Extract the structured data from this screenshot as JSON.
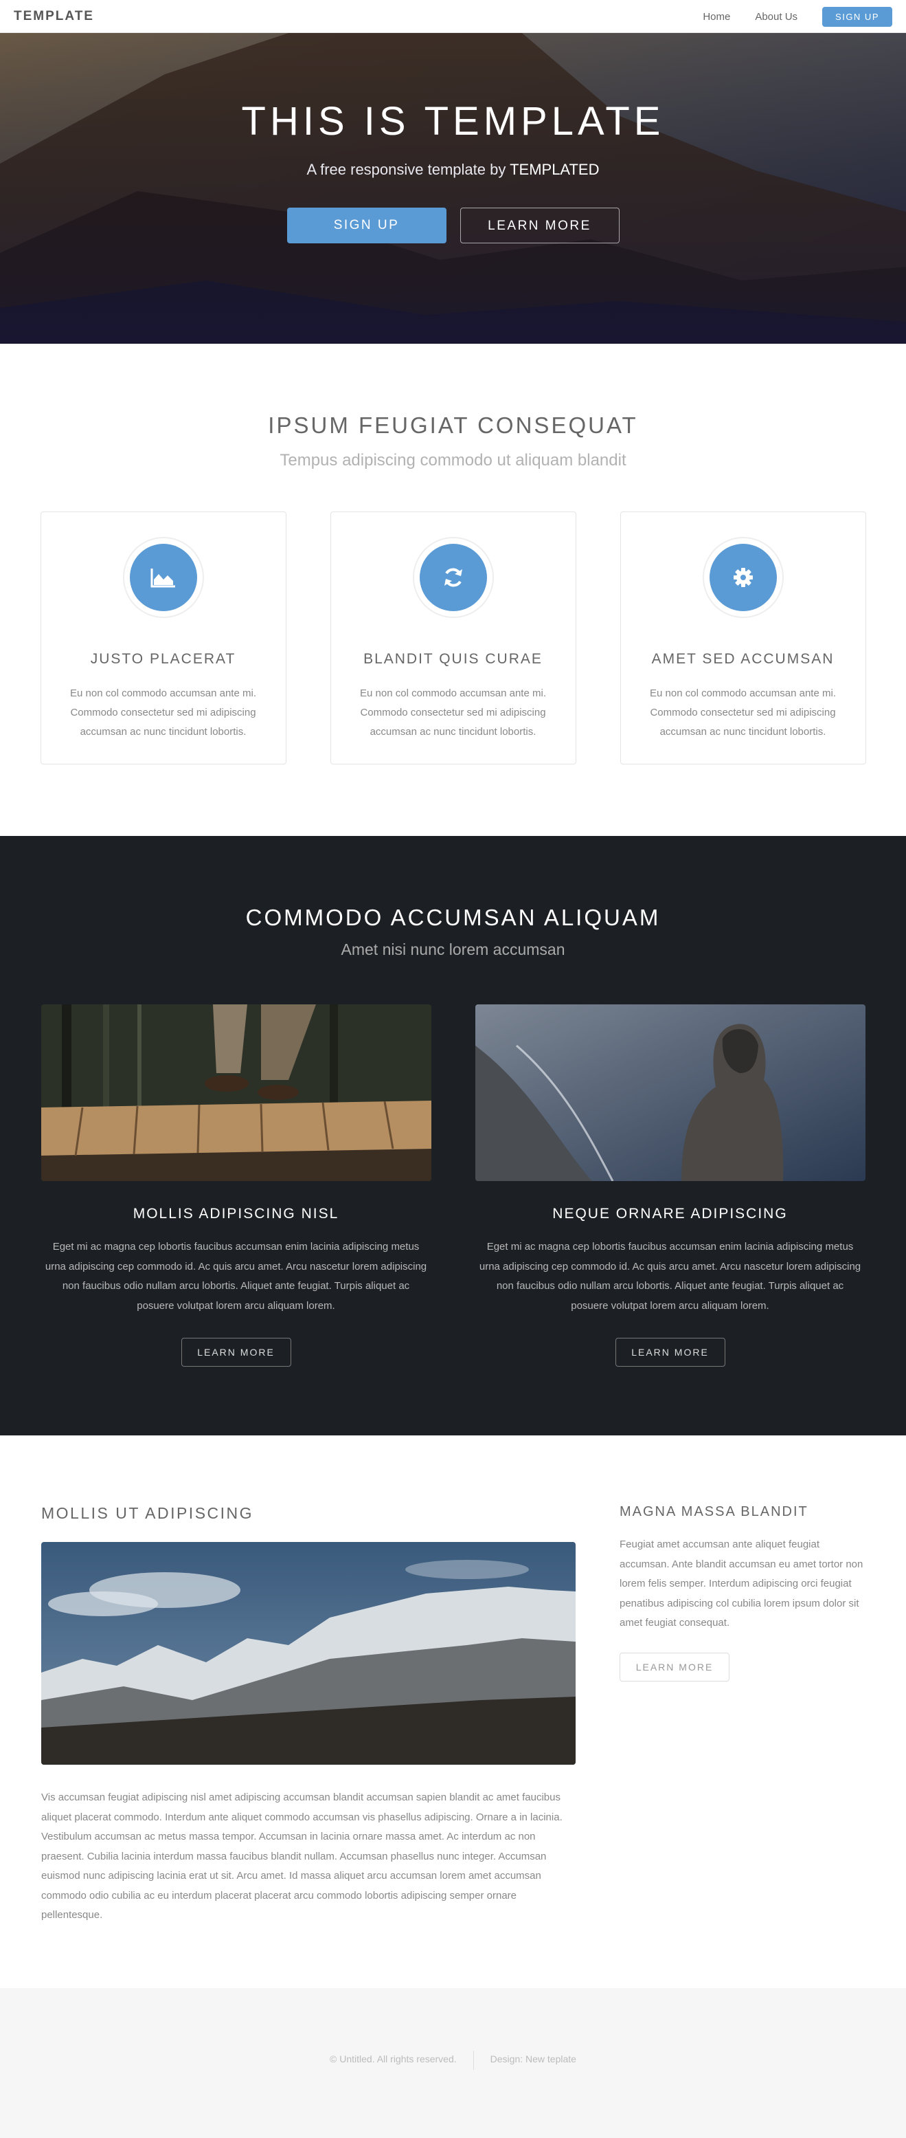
{
  "header": {
    "logo": "TEMPLATE",
    "nav": [
      "Home",
      "About Us"
    ],
    "signup": "SIGN UP"
  },
  "banner": {
    "title": "THIS IS TEMPLATE",
    "subtitle_prefix": "A free responsive template by",
    "subtitle_brand": "TEMPLATED",
    "primary_button": "SIGN UP",
    "secondary_button": "LEARN MORE"
  },
  "features": {
    "title": "IPSUM FEUGIAT CONSEQUAT",
    "subtitle": "Tempus adipiscing commodo ut aliquam blandit",
    "cards": [
      {
        "icon": "area-chart-icon",
        "title": "JUSTO PLACERAT",
        "text": "Eu non col commodo accumsan ante mi. Commodo consectetur sed mi adipiscing accumsan ac nunc tincidunt lobortis."
      },
      {
        "icon": "refresh-icon",
        "title": "BLANDIT QUIS CURAE",
        "text": "Eu non col commodo accumsan ante mi. Commodo consectetur sed mi adipiscing accumsan ac nunc tincidunt lobortis."
      },
      {
        "icon": "gear-icon",
        "title": "AMET SED ACCUMSAN",
        "text": "Eu non col commodo accumsan ante mi. Commodo consectetur sed mi adipiscing accumsan ac nunc tincidunt lobortis."
      }
    ]
  },
  "dark": {
    "title": "COMMODO ACCUMSAN ALIQUAM",
    "subtitle": "Amet nisi nunc lorem accumsan",
    "columns": [
      {
        "title": "MOLLIS ADIPISCING NISL",
        "text": "Eget mi ac magna cep lobortis faucibus accumsan enim lacinia adipiscing metus urna adipiscing cep commodo id. Ac quis arcu amet. Arcu nascetur lorem adipiscing non faucibus odio nullam arcu lobortis. Aliquet ante feugiat. Turpis aliquet ac posuere volutpat lorem arcu aliquam lorem.",
        "button": "LEARN MORE"
      },
      {
        "title": "NEQUE ORNARE ADIPISCING",
        "text": "Eget mi ac magna cep lobortis faucibus accumsan enim lacinia adipiscing metus urna adipiscing cep commodo id. Ac quis arcu amet. Arcu nascetur lorem adipiscing non faucibus odio nullam arcu lobortis. Aliquet ante feugiat. Turpis aliquet ac posuere volutpat lorem arcu aliquam lorem.",
        "button": "LEARN MORE"
      }
    ]
  },
  "main": {
    "title": "MOLLIS UT ADIPISCING",
    "text": "Vis accumsan feugiat adipiscing nisl amet adipiscing accumsan blandit accumsan sapien blandit ac amet faucibus aliquet placerat commodo. Interdum ante aliquet commodo accumsan vis phasellus adipiscing. Ornare a in lacinia. Vestibulum accumsan ac metus massa tempor. Accumsan in lacinia ornare massa amet. Ac interdum ac non praesent. Cubilia lacinia interdum massa faucibus blandit nullam. Accumsan phasellus nunc integer. Accumsan euismod nunc adipiscing lacinia erat ut sit. Arcu amet. Id massa aliquet arcu accumsan lorem amet accumsan commodo odio cubilia ac eu interdum placerat placerat arcu commodo lobortis adipiscing semper ornare pellentesque."
  },
  "sidebar": {
    "title": "MAGNA MASSA BLANDIT",
    "text": "Feugiat amet accumsan ante aliquet feugiat accumsan. Ante blandit accumsan eu amet tortor non lorem felis semper. Interdum adipiscing orci feugiat penatibus adipiscing col cubilia lorem ipsum dolor sit amet feugiat consequat.",
    "button": "LEARN MORE"
  },
  "footer": {
    "copyright": "© Untitled. All rights reserved.",
    "credit": "Design: New teplate"
  },
  "colors": {
    "accent": "#5b9bd5",
    "dark_bg": "#1c2024",
    "footer_bg": "#f6f6f6"
  }
}
